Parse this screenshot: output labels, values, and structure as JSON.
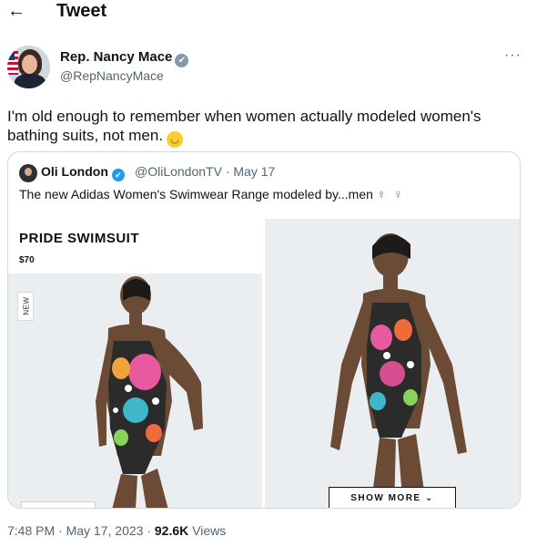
{
  "header": {
    "back_icon": "arrow-left-icon",
    "back_glyph": "←",
    "title": "Tweet"
  },
  "author": {
    "name": "Rep. Nancy Mace",
    "handle": "@RepNancyMace",
    "verified_badge": "✔",
    "more_glyph": "···"
  },
  "tweet": {
    "text": "I'm old enough to remember when women actually modeled women's bathing suits, not men.",
    "emoji_icon": "upside-down-face-emoji",
    "emoji_glyph": "◡"
  },
  "quote": {
    "name": "Oli London",
    "verified_badge": "✔",
    "handle": "@OliLondonTV",
    "separator": "·",
    "date": "May 17",
    "text": "The new Adidas Women's Swimwear Range modeled by...men",
    "trailing_icons": "♀ ♀",
    "images": {
      "left": {
        "product_title": "PRIDE SWIMSUIT",
        "price": "$70",
        "tag": "NEW"
      },
      "right": {
        "button_label": "SHOW MORE ⌄"
      }
    }
  },
  "meta": {
    "time": "7:48 PM",
    "sep1": "·",
    "date": "May 17, 2023",
    "sep2": "·",
    "views_count": "92.6K",
    "views_label": "Views"
  },
  "colors": {
    "text": "#0f1419",
    "secondary": "#536471",
    "border": "#cfd9de",
    "link_blue": "#1d9bf0"
  }
}
